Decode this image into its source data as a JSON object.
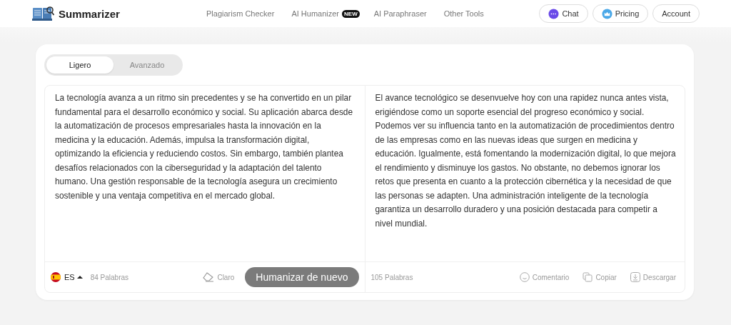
{
  "brand": {
    "name": "Summarizer"
  },
  "nav": [
    {
      "label": "Plagiarism Checker"
    },
    {
      "label": "AI Humanizer",
      "badge": "NEW"
    },
    {
      "label": "AI Paraphraser"
    },
    {
      "label": "Other Tools"
    }
  ],
  "header_buttons": [
    {
      "label": "Chat",
      "kind": "chat"
    },
    {
      "label": "Pricing",
      "kind": "pricing"
    },
    {
      "label": "Account",
      "kind": "plain"
    }
  ],
  "tabs": [
    {
      "label": "Ligero",
      "selected": true
    },
    {
      "label": "Avanzado",
      "selected": false
    }
  ],
  "input": {
    "text": "La tecnología avanza a un ritmo sin precedentes y se ha convertido en un pilar fundamental para el desarrollo económico y social. Su aplicación abarca desde la automatización de procesos empresariales hasta la innovación en la medicina y la educación. Además, impulsa la transformación digital, optimizando la eficiencia y reduciendo costos. Sin embargo, también plantea desafíos relacionados con la ciberseguridad y la adaptación del talento humano. Una gestión responsable de la tecnología asegura un crecimiento sostenible y una ventaja competitiva en el mercado global.",
    "language": "ES",
    "word_count": "84 Palabras",
    "clear": "Claro",
    "submit": "Humanizar de nuevo"
  },
  "output": {
    "text": "El avance tecnológico se desenvuelve hoy con una rapidez nunca antes vista, erigiéndose como un soporte esencial del progreso económico y social. Podemos ver su influencia tanto en la automatización de procedimientos dentro de las empresas como en las nuevas ideas que surgen en medicina y educación. Igualmente, está fomentando la modernización digital, lo que mejora el rendimiento y disminuye los gastos. No obstante, no debemos ignorar los retos que presenta en cuanto a la protección cibernética y la necesidad de que las personas se adapten. Una administración inteligente de la tecnología garantiza un desarrollo duradero y una posición destacada para competir a nivel mundial.",
    "word_count": "105 Palabras",
    "actions": [
      {
        "label": "Comentario",
        "kind": "feedback"
      },
      {
        "label": "Copiar",
        "kind": "copy"
      },
      {
        "label": "Descargar",
        "kind": "download"
      }
    ]
  }
}
